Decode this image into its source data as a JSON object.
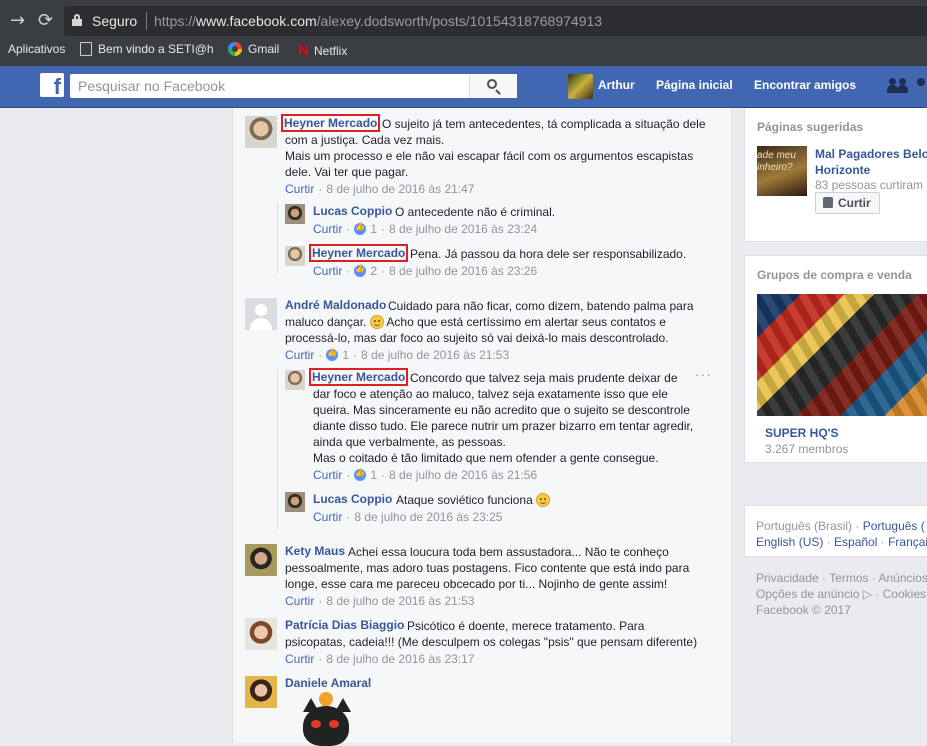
{
  "browser": {
    "secure_label": "Seguro",
    "url_prefix": "https://",
    "url_domain": "www.facebook.com",
    "url_path": "/alexey.dodsworth/posts/10154318768974913",
    "bookmarks": [
      {
        "label": "Aplicativos",
        "icon": "apps-icon"
      },
      {
        "label": "Bem vindo a SETI@h",
        "icon": "doc-icon"
      },
      {
        "label": "Gmail",
        "icon": "google-icon"
      },
      {
        "label": "Netflix",
        "icon": "netflix-icon"
      }
    ]
  },
  "header": {
    "search_placeholder": "Pesquisar no Facebook",
    "user_name": "Arthur",
    "home_label": "Página inicial",
    "find_friends_label": "Encontrar amigos"
  },
  "comments": [
    {
      "name": "Heyner Mercado",
      "text1": "O sujeito já tem antecedentes, tá complicada a situação dele",
      "text2": "com a justiça. Cada vez mais.",
      "text3": "Mais um processo e ele não vai escapar fácil com os argumentos escapistas",
      "text4": "dele. Vai ter que pagar.",
      "action": "Curtir",
      "date": "8 de julho de 2016 às 21:47"
    },
    {
      "name": "Lucas Coppio",
      "text": "O antecedente não é criminal.",
      "action": "Curtir",
      "likes": "1",
      "date": "8 de julho de 2016 às 23:24"
    },
    {
      "name": "Heyner Mercado",
      "text": "Pena. Já passou da hora dele ser responsabilizado.",
      "action": "Curtir",
      "likes": "2",
      "date": "8 de julho de 2016 às 23:26"
    },
    {
      "name": "André Maldonado",
      "text1": "Cuidado para não ficar, como dizem, batendo palma para",
      "text2a": "maluco dançar.",
      "text2b": "Acho que está certíssimo em alertar seus contatos e",
      "text3": "processá-lo, mas dar foco ao sujeito só vai deixá-lo mais descontrolado.",
      "action": "Curtir",
      "likes": "1",
      "date": "8 de julho de 2016 às 21:53"
    },
    {
      "name": "Heyner Mercado",
      "text1": "Concordo que talvez seja mais prudente deixar de",
      "text2": "dar foco e atenção ao maluco, talvez seja exatamente isso que ele",
      "text3": "queira. Mas sinceramente eu não acredito que o sujeito se descontrole",
      "text4": "diante disso tudo. Ele parece nutrir um prazer bizarro em tentar agredir,",
      "text5": "ainda que verbalmente, as pessoas.",
      "text6": "Mas o coitado é tão limitado que nem ofender a gente consegue.",
      "action": "Curtir",
      "likes": "1",
      "date": "8 de julho de 2016 às 21:56",
      "more": "···"
    },
    {
      "name": "Lucas Coppio",
      "text": "Ataque soviético funciona",
      "action": "Curtir",
      "date": "8 de julho de 2016 às 23:25"
    },
    {
      "name": "Kety Maus",
      "text1": "Achei essa loucura toda bem assustadora... Não te conheço",
      "text2": "pessoalmente, mas adoro tuas postagens. Fico contente que está indo para",
      "text3": "longe, esse cara me pareceu obcecado por ti... Nojinho de gente assim!",
      "action": "Curtir",
      "date": "8 de julho de 2016 às 21:53"
    },
    {
      "name": "Patrícia Dias Biaggio",
      "text1": "Psicótico é doente, merece tratamento. Para",
      "text2": "psicopatas, cadeia!!! (Me desculpem os colegas \"psis\" que pensam diferente)",
      "action": "Curtir",
      "date": "8 de julho de 2016 às 23:17"
    },
    {
      "name": "Daniele Amaral"
    }
  ],
  "sidebar": {
    "suggested_title": "Páginas sugeridas",
    "suggested_img_text": "ade meu\ninheiro?",
    "suggested_name": "Mal Pagadores Belo Horizonte",
    "suggested_sub": "83 pessoas curtiram",
    "like_button": "Curtir",
    "groups_title": "Grupos de compra e venda",
    "group_name": "SUPER HQ'S",
    "group_members": "3.267 membros",
    "lang_current": "Português (Brasil)",
    "lang_links": [
      "Português (",
      "English (US)",
      "Español",
      "Françai"
    ],
    "footer1": "Privacidade · Termos · Anúncios",
    "footer2": "Opções de anúncio ▷ · Cookies",
    "footer3": "Facebook © 2017"
  }
}
